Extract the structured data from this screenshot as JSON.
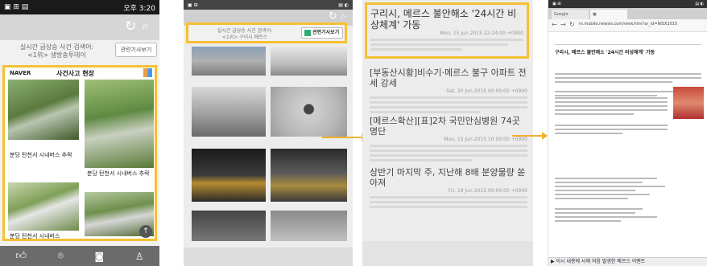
{
  "screen1": {
    "status_time": "오후 3:20",
    "alert_title": "실시간 급상승 사건 검색어:",
    "alert_sub": "<1위> 생방송투데이",
    "related_btn": "관련기사보기",
    "brand": "NAVER",
    "section": "사건사고 현장",
    "captions": [
      "분당 탄천서 시내버스 추락",
      "분당 탄천서 시내버스 추락",
      "분당 탄천서 시내버스",
      "분당 탄천서 시내버스"
    ]
  },
  "screen2": {
    "alert_title": "실시간 급상승 사건 검색어:",
    "alert_sub": "<1위> 구리시 메르스",
    "related_btn": "관련기사보기"
  },
  "screen3": {
    "articles": [
      {
        "title": "구리시, 메르스 불안해소 '24시간 비상체계' 가동",
        "date": "Mon, 15 Jun 2015 22:24:00 +0900"
      },
      {
        "title": "[부동산시황]비수기·메르스 불구 아파트 전세 강세",
        "date": "Sat, 20 Jun 2015 00:00:00 +0900"
      },
      {
        "title": "[메르스확산][표]2차 국민안심병원 74곳 명단",
        "date": "Mon, 15 Jun 2015 10:00:00 +0900"
      },
      {
        "title": "상반기 마지막 주, 지난해 8배 분양물량 쏟아져",
        "date": "Fri, 19 Jun 2015 00:00:00 +0900"
      }
    ]
  },
  "screen4": {
    "tab_label": "Google",
    "url": "m.mobile.newsis.com/view.htm?ar_id=NISX2015",
    "headline": "구리시, 메르스 불안해소 '24시간 비상체계' 가동",
    "ticker": "▶ 이시 내용에 사해 처음 발생한 메르스 이벤트"
  },
  "colors": {
    "highlight": "#f6c033",
    "statusbar": "#1a1a1a"
  }
}
